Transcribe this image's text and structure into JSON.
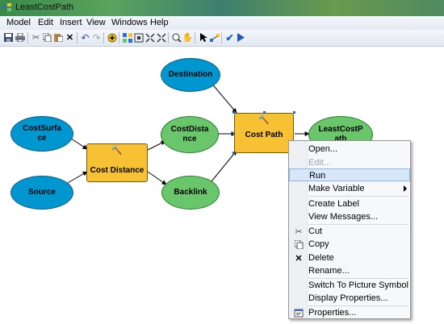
{
  "window": {
    "title": "LeastCostPath"
  },
  "menubar": {
    "items": [
      "Model",
      "Edit",
      "Insert",
      "View",
      "Windows",
      "Help"
    ]
  },
  "toolbar": {
    "icons": [
      "save-icon",
      "print-icon",
      "cut-icon",
      "copy-icon",
      "paste-icon",
      "delete-icon",
      "undo-icon",
      "redo-icon",
      "add-data-icon",
      "auto-layout-icon",
      "full-extent-icon",
      "fixed-zoom-icon",
      "zoom-in-icon",
      "pan-icon",
      "select-icon",
      "connect-icon",
      "validate-icon",
      "run-icon"
    ]
  },
  "model": {
    "nodes": {
      "destination": "Destination",
      "cost_surface": "CostSurface",
      "source": "Source",
      "cost_distance_tool": "Cost Distance",
      "cost_distance_output": "CostDistance",
      "backlink": "Backlink",
      "cost_path_tool": "Cost Path",
      "least_cost_path": "LeastCostPath"
    },
    "colors": {
      "data": "#0097d0",
      "derived": "#6ac66b",
      "tool": "#f6c233"
    }
  },
  "context_menu": {
    "items": [
      {
        "label": "Open...",
        "enabled": true
      },
      {
        "label": "Edit...",
        "enabled": false
      },
      {
        "label": "Run",
        "enabled": true,
        "highlighted": true
      },
      {
        "label": "Make Variable",
        "enabled": true,
        "submenu": true
      },
      {
        "label": "Create Label",
        "enabled": true
      },
      {
        "label": "View Messages...",
        "enabled": true
      },
      {
        "label": "Cut",
        "enabled": true,
        "icon": "scissors-icon"
      },
      {
        "label": "Copy",
        "enabled": true,
        "icon": "copy-icon"
      },
      {
        "label": "Delete",
        "enabled": true,
        "icon": "delete-x-icon"
      },
      {
        "label": "Rename...",
        "enabled": true
      },
      {
        "label": "Switch To Picture Symbol",
        "enabled": true
      },
      {
        "label": "Display Properties...",
        "enabled": true
      },
      {
        "label": "Properties...",
        "enabled": true,
        "icon": "properties-icon"
      }
    ]
  }
}
